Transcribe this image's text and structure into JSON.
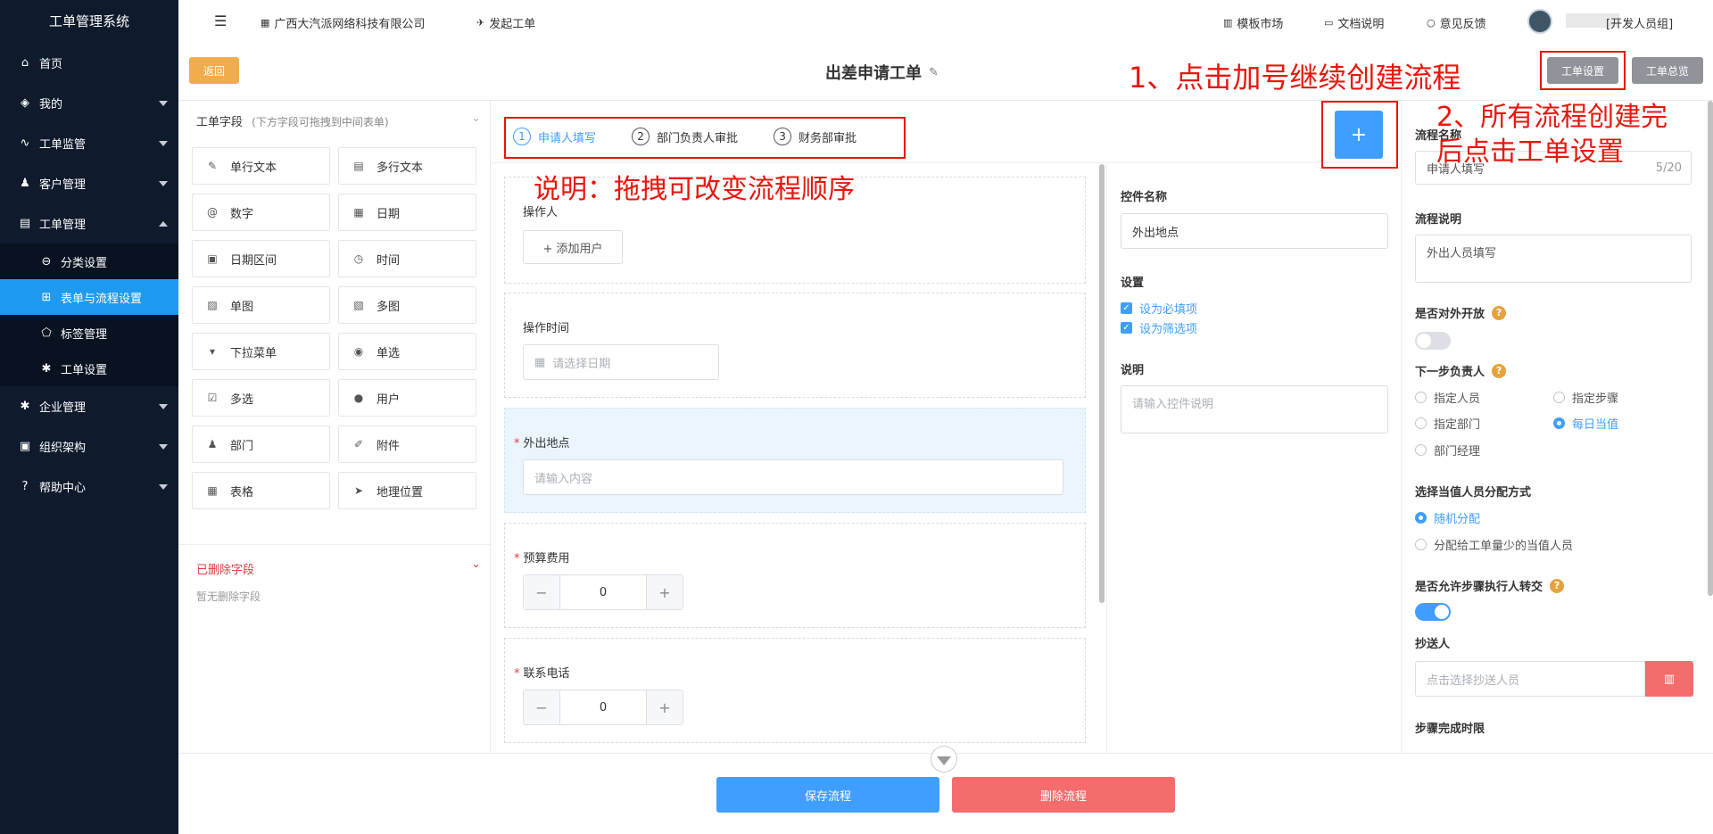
{
  "sidebar": {
    "title": "工单管理系统",
    "items": [
      {
        "label": "首页"
      },
      {
        "label": "我的"
      },
      {
        "label": "工单监管"
      },
      {
        "label": "客户管理"
      },
      {
        "label": "工单管理"
      },
      {
        "label": "企业管理"
      },
      {
        "label": "组织架构"
      },
      {
        "label": "帮助中心"
      }
    ],
    "sub_items": [
      {
        "label": "分类设置"
      },
      {
        "label": "表单与流程设置"
      },
      {
        "label": "标签管理"
      },
      {
        "label": "工单设置"
      }
    ]
  },
  "topbar": {
    "company": "广西大汽派网络科技有限公司",
    "launch": "发起工单",
    "template_market": "模板市场",
    "docs": "文档说明",
    "feedback": "意见反馈",
    "user_group": "[开发人员组]"
  },
  "header": {
    "back": "返回",
    "title": "出差申请工单",
    "settings": "工单设置",
    "overview": "工单总览"
  },
  "fields_panel": {
    "title": "工单字段",
    "hint": "(下方字段可拖拽到中间表单)",
    "fields": [
      {
        "label": "单行文本",
        "icon": "✎"
      },
      {
        "label": "多行文本",
        "icon": "▤"
      },
      {
        "label": "数字",
        "icon": "@"
      },
      {
        "label": "日期",
        "icon": "▦"
      },
      {
        "label": "日期区间",
        "icon": "▣"
      },
      {
        "label": "时间",
        "icon": "◷"
      },
      {
        "label": "单图",
        "icon": "▨"
      },
      {
        "label": "多图",
        "icon": "▧"
      },
      {
        "label": "下拉菜单",
        "icon": "▾"
      },
      {
        "label": "单选",
        "icon": "◉"
      },
      {
        "label": "多选",
        "icon": "☑"
      },
      {
        "label": "用户",
        "icon": "●"
      },
      {
        "label": "部门",
        "icon": "♟"
      },
      {
        "label": "附件",
        "icon": "✐"
      },
      {
        "label": "表格",
        "icon": "▦"
      },
      {
        "label": "地理位置",
        "icon": "➤"
      }
    ],
    "deleted_title": "已删除字段",
    "deleted_empty": "暂无删除字段"
  },
  "steps": [
    {
      "num": "1",
      "label": "申请人填写"
    },
    {
      "num": "2",
      "label": "部门负责人审批"
    },
    {
      "num": "3",
      "label": "财务部审批"
    }
  ],
  "add_step": "+",
  "canvas": {
    "operator_label": "操作人",
    "add_user": "+ 添加用户",
    "op_time_label": "操作时间",
    "date_placeholder": "请选择日期",
    "location_label": "外出地点",
    "location_placeholder": "请输入内容",
    "budget_label": "预算费用",
    "budget_value": "0",
    "phone_label": "联系电话",
    "phone_value": "0",
    "minus": "−",
    "plus": "+"
  },
  "control_props": {
    "name_label": "控件名称",
    "name_value": "外出地点",
    "settings_label": "设置",
    "required": "设为必填项",
    "filter": "设为筛选项",
    "desc_label": "说明",
    "desc_placeholder": "请输入控件说明"
  },
  "flow_props": {
    "name_label": "流程名称",
    "name_value": "申请人填写",
    "name_count": "5/20",
    "desc_label": "流程说明",
    "desc_value": "外出人员填写",
    "open_label": "是否对外开放",
    "next_label": "下一步负责人",
    "next_options": [
      {
        "label": "指定人员",
        "checked": false
      },
      {
        "label": "指定步骤",
        "checked": false
      },
      {
        "label": "指定部门",
        "checked": false
      },
      {
        "label": "每日当值",
        "checked": true
      },
      {
        "label": "部门经理",
        "checked": false
      }
    ],
    "assign_label": "选择当值人员分配方式",
    "assign_options": [
      {
        "label": "随机分配",
        "checked": true
      },
      {
        "label": "分配给工单量少的当值人员",
        "checked": false
      }
    ],
    "transfer_label": "是否允许步骤执行人转交",
    "transfer_on": true,
    "open_on": false,
    "cc_label": "抄送人",
    "cc_placeholder": "点击选择抄送人员",
    "deadline_label": "步骤完成时限",
    "qmark": "?"
  },
  "footer": {
    "save": "保存流程",
    "delete": "删除流程"
  },
  "annotations": {
    "a1": "1、点击加号继续创建流程",
    "a2_line1": "2、所有流程创建完",
    "a2_line2": "后点击工单设置",
    "a3": "说明：拖拽可改变流程顺序"
  },
  "colors": {
    "sidebar_bg": "#0f1b2d",
    "active_blue": "#1e9bf0",
    "primary": "#409eff",
    "danger": "#f56c6c",
    "back_btn": "#f0ad4e",
    "annotation_red": "#e8160c"
  }
}
